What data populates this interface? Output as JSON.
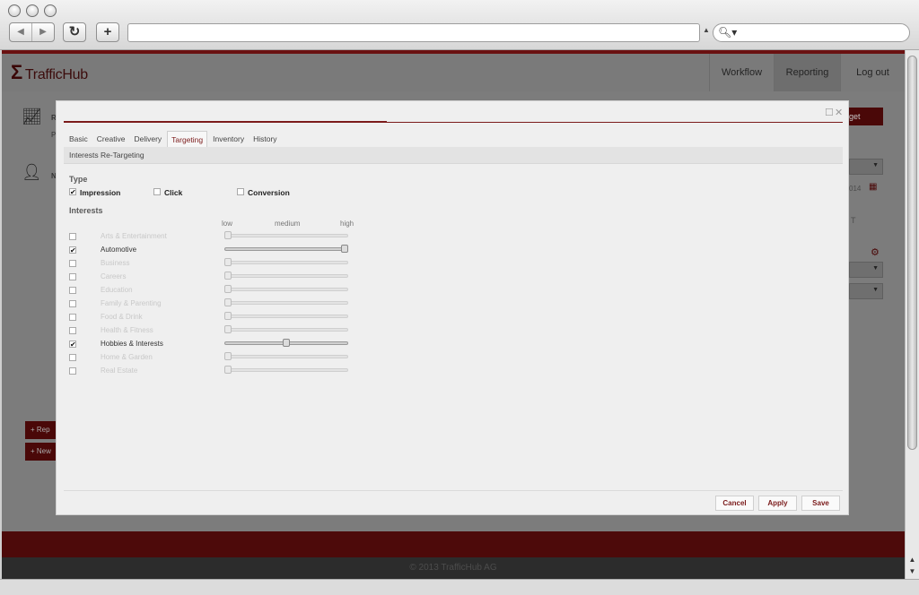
{
  "browser": {
    "back_glyph": "◀",
    "forward_glyph": "▶",
    "reload_glyph": "↻",
    "newtab_glyph": "+",
    "url_value": "",
    "search_glyph": "🔍︎▾",
    "url_dropdown_glyph": "▲"
  },
  "app": {
    "logo_mark": "Σ",
    "logo_text": "TrafficHub",
    "nav": [
      "Workflow",
      "Reporting",
      "Log out"
    ],
    "footer": "© 2013 TrafficHub AG",
    "bg_button_right_text": "get",
    "bg_date_text": "014",
    "bg_left_btn1": "+ Rep",
    "bg_left_btn2": "+ New",
    "bg_letter_r": "R",
    "bg_letter_p": "P",
    "bg_letter_n": "N",
    "bg_letter_t": "T"
  },
  "modal": {
    "tabs": [
      "Basic",
      "Creative",
      "Delivery",
      "Targeting",
      "Inventory",
      "History"
    ],
    "active_tab": "Targeting",
    "section_title": "Interests Re-Targeting",
    "type_heading": "Type",
    "types": [
      {
        "label": "Impression",
        "checked": true
      },
      {
        "label": "Click",
        "checked": false
      },
      {
        "label": "Conversion",
        "checked": false
      }
    ],
    "interests_heading": "Interests",
    "scale": {
      "low": "low",
      "medium": "medium",
      "high": "high"
    },
    "interests": [
      {
        "label": "Arts & Entertainment",
        "checked": false,
        "level": 0
      },
      {
        "label": "Automotive",
        "checked": true,
        "level": 1.0
      },
      {
        "label": "Business",
        "checked": false,
        "level": 0
      },
      {
        "label": "Careers",
        "checked": false,
        "level": 0
      },
      {
        "label": "Education",
        "checked": false,
        "level": 0
      },
      {
        "label": "Family & Parenting",
        "checked": false,
        "level": 0
      },
      {
        "label": "Food & Drink",
        "checked": false,
        "level": 0
      },
      {
        "label": "Health & Fitness",
        "checked": false,
        "level": 0
      },
      {
        "label": "Hobbies & Interests",
        "checked": true,
        "level": 0.5
      },
      {
        "label": "Home & Garden",
        "checked": false,
        "level": 0
      },
      {
        "label": "Real Estate",
        "checked": false,
        "level": 0
      }
    ],
    "buttons": {
      "cancel": "Cancel",
      "apply": "Apply",
      "save": "Save"
    },
    "controls": {
      "maximize": "☐",
      "close": "✕"
    },
    "check_glyph": "✔"
  },
  "scrollbar": {
    "up": "▲",
    "down": "▼"
  }
}
